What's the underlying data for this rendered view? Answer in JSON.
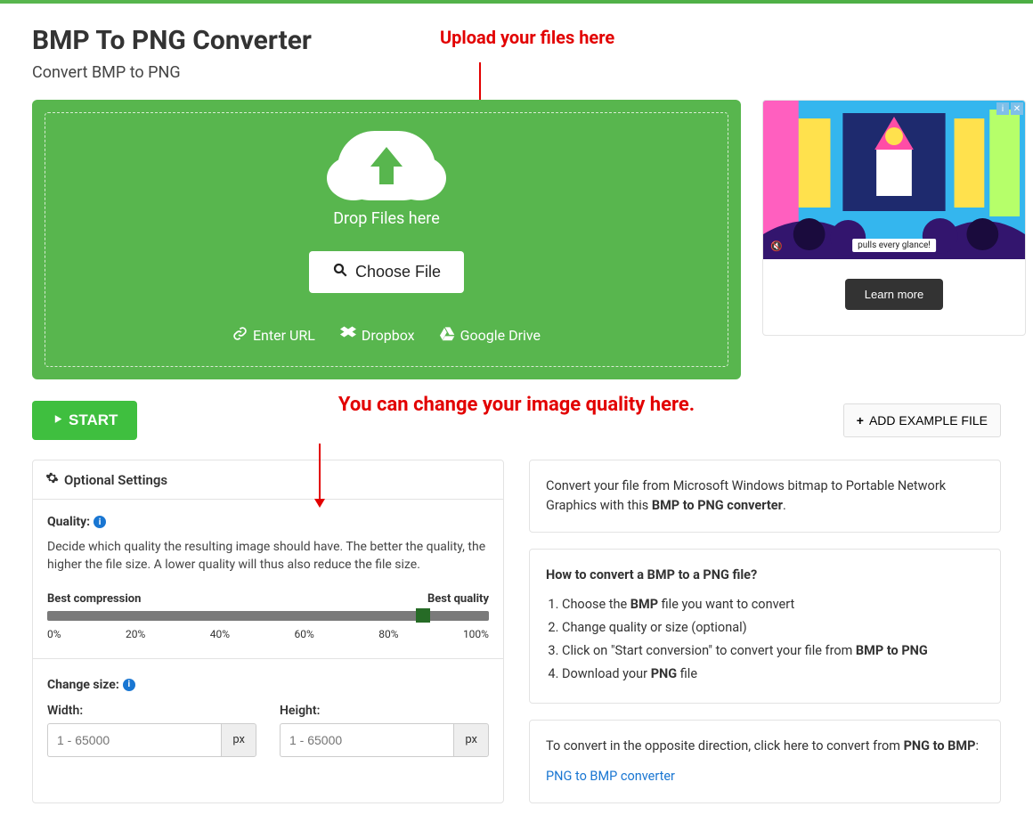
{
  "header": {
    "title": "BMP To PNG Converter",
    "subtitle": "Convert BMP to PNG"
  },
  "annotations": {
    "upload": "Upload your files here",
    "quality": "You can change your image quality here."
  },
  "dropzone": {
    "drop_label": "Drop Files here",
    "choose_label": "Choose File",
    "sources": {
      "url": "Enter URL",
      "dropbox": "Dropbox",
      "gdrive": "Google Drive"
    }
  },
  "ad": {
    "caption": "pulls every glance!",
    "learn": "Learn more"
  },
  "actions": {
    "start": "START",
    "add_example": "ADD EXAMPLE FILE"
  },
  "settings": {
    "panel_title": "Optional Settings",
    "quality_label": "Quality:",
    "quality_desc": "Decide which quality the resulting image should have. The better the quality, the higher the file size. A lower quality will thus also reduce the file size.",
    "slider_left": "Best compression",
    "slider_right": "Best quality",
    "slider_value_percent": 85,
    "ticks": [
      "0%",
      "20%",
      "40%",
      "60%",
      "80%",
      "100%"
    ],
    "change_size_label": "Change size:",
    "width_label": "Width:",
    "height_label": "Height:",
    "placeholder": "1 - 65000",
    "unit": "px"
  },
  "info": {
    "convert_text_a": "Convert your file from Microsoft Windows bitmap to Portable Network Graphics with this ",
    "convert_text_b": "BMP to PNG converter",
    "howto_title": "How to convert a BMP to a PNG file?",
    "steps": {
      "s1a": "Choose the ",
      "s1b": "BMP",
      "s1c": " file you want to convert",
      "s2": "Change quality or size (optional)",
      "s3a": "Click on \"Start conversion\" to convert your file from ",
      "s3b": "BMP to PNG",
      "s4a": "Download your ",
      "s4b": "PNG",
      "s4c": " file"
    },
    "opposite_a": "To convert in the opposite direction, click here to convert from ",
    "opposite_b": "PNG to BMP",
    "opposite_link": "PNG to BMP converter"
  }
}
